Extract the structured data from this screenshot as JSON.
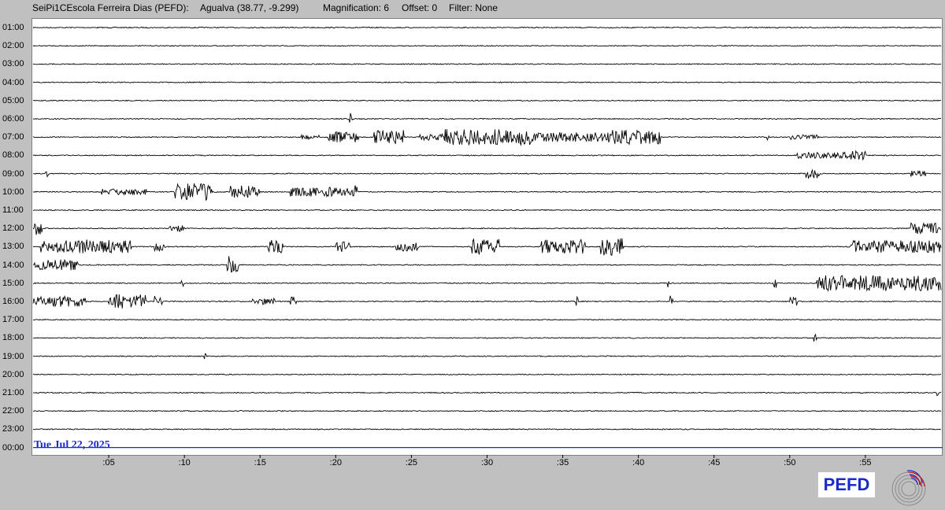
{
  "header": {
    "station": "SeiPi1CEscola Ferreira Dias (PEFD):",
    "location": "Agualva (38.77, -9.299)",
    "magnification": "Magnification: 6",
    "offset": "Offset: 0",
    "filter": "Filter: None"
  },
  "date_label": "Tue Jul 22, 2025",
  "logo": {
    "text": "PEFD",
    "mark_icon": "concentric-circles-logo-icon"
  },
  "chart_data": {
    "type": "line",
    "title": "",
    "hour_labels": [
      "01:00",
      "02:00",
      "03:00",
      "04:00",
      "05:00",
      "06:00",
      "07:00",
      "08:00",
      "09:00",
      "10:00",
      "11:00",
      "12:00",
      "13:00",
      "14:00",
      "15:00",
      "16:00",
      "17:00",
      "18:00",
      "19:00",
      "20:00",
      "21:00",
      "22:00",
      "23:00",
      "00:00"
    ],
    "minute_ticks": [
      ":05",
      ":10",
      ":15",
      ":20",
      ":25",
      ":30",
      ":35",
      ":40",
      ":45",
      ":50",
      ":55"
    ],
    "minute_values": [
      5,
      10,
      15,
      20,
      25,
      30,
      35,
      40,
      45,
      50,
      55
    ],
    "x_range_minutes": [
      0,
      60
    ],
    "trace_color": "#000000",
    "current_line_color": "#1a2bcc",
    "current_line_index": 23,
    "rows": [
      {
        "hour": "01:00",
        "bursts": []
      },
      {
        "hour": "02:00",
        "bursts": []
      },
      {
        "hour": "03:00",
        "bursts": []
      },
      {
        "hour": "04:00",
        "bursts": []
      },
      {
        "hour": "05:00",
        "bursts": []
      },
      {
        "hour": "06:00",
        "bursts": [
          {
            "start": 20.9,
            "end": 21.1,
            "amp": 10
          }
        ]
      },
      {
        "hour": "07:00",
        "bursts": [
          {
            "start": 17.5,
            "end": 19,
            "amp": 3
          },
          {
            "start": 19.5,
            "end": 21.5,
            "amp": 7
          },
          {
            "start": 22.5,
            "end": 24.5,
            "amp": 9
          },
          {
            "start": 25.5,
            "end": 27,
            "amp": 4
          },
          {
            "start": 27,
            "end": 33,
            "amp": 10
          },
          {
            "start": 33,
            "end": 38,
            "amp": 6
          },
          {
            "start": 38,
            "end": 41.5,
            "amp": 9
          },
          {
            "start": 48.5,
            "end": 48.7,
            "amp": 6
          },
          {
            "start": 50,
            "end": 52,
            "amp": 3
          }
        ]
      },
      {
        "hour": "08:00",
        "bursts": [
          {
            "start": 50.5,
            "end": 54,
            "amp": 4
          },
          {
            "start": 54,
            "end": 55,
            "amp": 6
          }
        ]
      },
      {
        "hour": "09:00",
        "bursts": [
          {
            "start": 0.8,
            "end": 1,
            "amp": 4
          },
          {
            "start": 51,
            "end": 52,
            "amp": 6
          },
          {
            "start": 58,
            "end": 59,
            "amp": 4
          }
        ]
      },
      {
        "hour": "10:00",
        "bursts": [
          {
            "start": 4.5,
            "end": 7.5,
            "amp": 4
          },
          {
            "start": 9.3,
            "end": 11.8,
            "amp": 11
          },
          {
            "start": 13,
            "end": 15,
            "amp": 8
          },
          {
            "start": 17,
            "end": 21,
            "amp": 6
          },
          {
            "start": 21,
            "end": 21.4,
            "amp": 10
          }
        ]
      },
      {
        "hour": "11:00",
        "bursts": []
      },
      {
        "hour": "12:00",
        "bursts": [
          {
            "start": 0.1,
            "end": 0.6,
            "amp": 9
          },
          {
            "start": 9,
            "end": 10,
            "amp": 4
          },
          {
            "start": 58,
            "end": 60,
            "amp": 7
          }
        ]
      },
      {
        "hour": "13:00",
        "bursts": [
          {
            "start": 0.5,
            "end": 3,
            "amp": 8
          },
          {
            "start": 3,
            "end": 6.5,
            "amp": 9
          },
          {
            "start": 8,
            "end": 8.8,
            "amp": 6
          },
          {
            "start": 15.5,
            "end": 16.5,
            "amp": 9
          },
          {
            "start": 20,
            "end": 21,
            "amp": 7
          },
          {
            "start": 24,
            "end": 25.5,
            "amp": 6
          },
          {
            "start": 29,
            "end": 30.8,
            "amp": 10
          },
          {
            "start": 33.5,
            "end": 36.5,
            "amp": 9
          },
          {
            "start": 37.5,
            "end": 39,
            "amp": 11
          },
          {
            "start": 54,
            "end": 60,
            "amp": 8
          }
        ]
      },
      {
        "hour": "14:00",
        "bursts": [
          {
            "start": 0.1,
            "end": 3,
            "amp": 7
          },
          {
            "start": 12.8,
            "end": 13.6,
            "amp": 12
          }
        ]
      },
      {
        "hour": "15:00",
        "bursts": [
          {
            "start": 9.8,
            "end": 10,
            "amp": 7
          },
          {
            "start": 41.9,
            "end": 42,
            "amp": 9
          },
          {
            "start": 48.9,
            "end": 49.1,
            "amp": 6
          },
          {
            "start": 51.8,
            "end": 60,
            "amp": 10
          }
        ]
      },
      {
        "hour": "16:00",
        "bursts": [
          {
            "start": 0,
            "end": 3.5,
            "amp": 7
          },
          {
            "start": 5,
            "end": 7.5,
            "amp": 9
          },
          {
            "start": 8,
            "end": 8.6,
            "amp": 7
          },
          {
            "start": 14.5,
            "end": 16,
            "amp": 4
          },
          {
            "start": 17,
            "end": 17.4,
            "amp": 6
          },
          {
            "start": 35.8,
            "end": 36,
            "amp": 6
          },
          {
            "start": 42.1,
            "end": 42.3,
            "amp": 8
          },
          {
            "start": 50,
            "end": 50.6,
            "amp": 6
          }
        ]
      },
      {
        "hour": "17:00",
        "bursts": []
      },
      {
        "hour": "18:00",
        "bursts": [
          {
            "start": 51.6,
            "end": 51.8,
            "amp": 7
          }
        ]
      },
      {
        "hour": "19:00",
        "bursts": [
          {
            "start": 11.3,
            "end": 11.5,
            "amp": 4
          }
        ]
      },
      {
        "hour": "20:00",
        "bursts": []
      },
      {
        "hour": "21:00",
        "bursts": [
          {
            "start": 59.6,
            "end": 59.8,
            "amp": 4
          }
        ]
      },
      {
        "hour": "22:00",
        "bursts": []
      },
      {
        "hour": "23:00",
        "bursts": []
      },
      {
        "hour": "00:00",
        "bursts": []
      }
    ]
  }
}
